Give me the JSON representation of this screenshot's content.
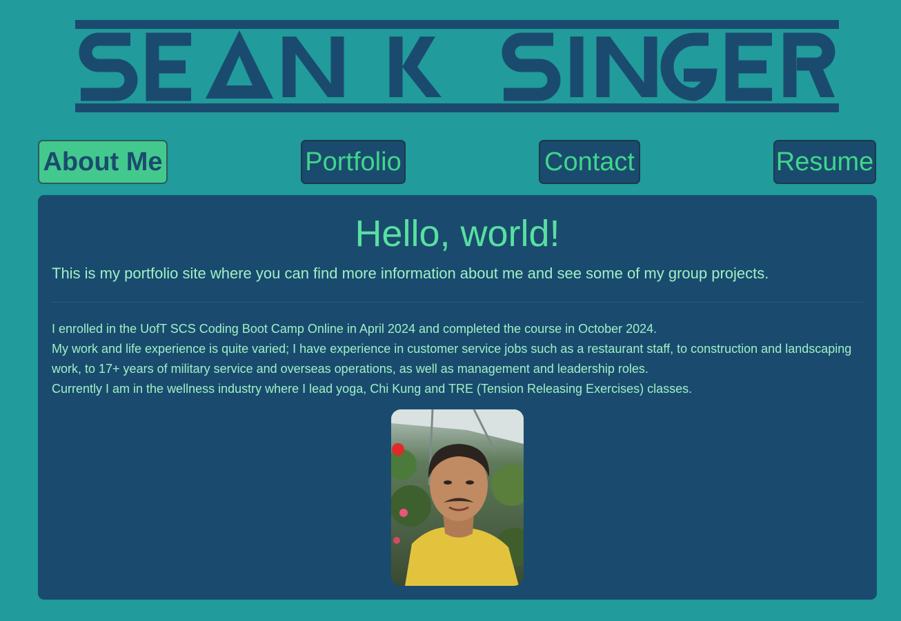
{
  "site": {
    "logo_text": "SEAN K SINGER",
    "colors": {
      "background": "#219b9b",
      "navy": "#1a4b6e",
      "accent_green": "#3fd68b",
      "text_mint": "#9ff0c6"
    }
  },
  "nav": {
    "items": [
      {
        "label": "About Me",
        "active": true
      },
      {
        "label": "Portfolio",
        "active": false
      },
      {
        "label": "Contact",
        "active": false
      },
      {
        "label": "Resume",
        "active": false
      }
    ]
  },
  "main": {
    "heading": "Hello, world!",
    "lead": "This is my portfolio site where you can find more information about me and see some of my group projects.",
    "bio": [
      "I enrolled in the UofT SCS Coding Boot Camp Online in April 2024 and completed the course in October 2024.",
      "My work and life experience is quite varied; I have experience in customer service jobs such as a restaurant staff, to construction and landscaping work, to 17+ years of military service and overseas operations, as well as management and leadership roles.",
      "Currently I am in the wellness industry where I lead yoga, Chi Kung and TRE (Tension Releasing Exercises) classes."
    ],
    "photo_icon": "profile-photo"
  }
}
